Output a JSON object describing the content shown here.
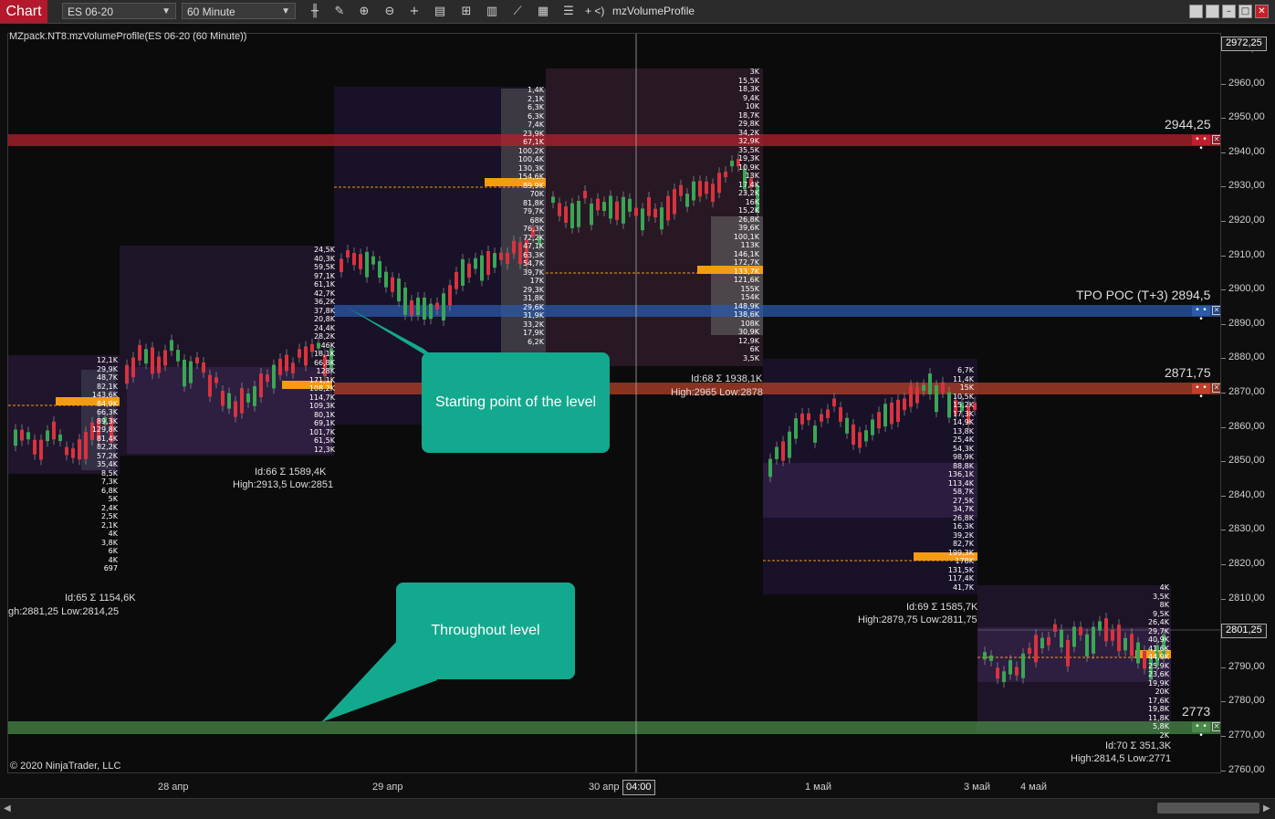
{
  "toolbar": {
    "chart_label": "Chart",
    "instrument": "ES 06-20",
    "interval": "60 Minute",
    "indicator_label": "mzVolumeProfile",
    "nav_text": "+ <)",
    "icons": [
      "bars-icon",
      "pencil-icon",
      "zoom-in-icon",
      "zoom-out-icon",
      "crosshair-icon",
      "data-box-icon",
      "strategy-icon",
      "chart-style-icon",
      "drawing-tools-icon",
      "properties-icon",
      "templates-icon"
    ]
  },
  "chart": {
    "indicator_title": "MZpack.NT8.mzVolumeProfile(ES 06-20 (60 Minute))",
    "copyright": "© 2020 NinjaTrader, LLC",
    "y_axis": {
      "ticks": [
        "2970,00",
        "2960,00",
        "2950,00",
        "2940,00",
        "2930,00",
        "2920,00",
        "2910,00",
        "2900,00",
        "2890,00",
        "2880,00",
        "2870,00",
        "2860,00",
        "2850,00",
        "2840,00",
        "2830,00",
        "2820,00",
        "2810,00",
        "2800,00",
        "2790,00",
        "2780,00",
        "2770,00",
        "2760,00"
      ],
      "top_flag": "2972,25",
      "price_flag": "2801,25"
    },
    "x_axis": {
      "labels": [
        "28 апр",
        "29 апр",
        "30 апр",
        "1 май",
        "3 май",
        "4 май"
      ],
      "cursor_flag": "04:00"
    },
    "levels": [
      {
        "label": "2944,25",
        "color": "#b3202e"
      },
      {
        "label": "TPO POC (T+3) 2894,5",
        "color": "#2a5aa8"
      },
      {
        "label": "2871,75",
        "color": "#b3402a"
      },
      {
        "label": "2773",
        "color": "#4a8a4a"
      }
    ],
    "profiles": [
      {
        "id_line": "Id:65 Σ 1154,6K",
        "range_line": "gh:2881,25 Low:2814,25"
      },
      {
        "id_line": "Id:66 Σ 1589,4K",
        "range_line": "High:2913,5 Low:2851"
      },
      {
        "id_line": "Id:68 Σ 1938,1K",
        "range_line": "High:2965 Low:2878"
      },
      {
        "id_line": "Id:69 Σ 1585,7K",
        "range_line": "High:2879,75 Low:2811,75"
      },
      {
        "id_line": "Id:70 Σ 351,3K",
        "range_line": "High:2814,5 Low:2771"
      }
    ],
    "volume_columns": {
      "p65": [
        "12,1K",
        "29,9K",
        "48,7K",
        "82,1K",
        "143,6K",
        "84,9K",
        "66,3K",
        "89,3K",
        "129,8K",
        "81,4K",
        "82,2K",
        "57,2K",
        "35,4K",
        "8,5K",
        "7,3K",
        "6,8K",
        "5K",
        "2,4K",
        "2,5K",
        "2,1K",
        "4K",
        "3,8K",
        "6K",
        "4K",
        "697"
      ],
      "p66": [
        "24,5K",
        "40,3K",
        "59,5K",
        "97,1K",
        "61,1K",
        "42,7K",
        "36,2K",
        "37,8K",
        "20,8K",
        "24,4K",
        "28,2K",
        "46K",
        "18,1K",
        "66,8K",
        "128K",
        "171,1K",
        "108,2K",
        "114,7K",
        "109,3K",
        "80,1K",
        "69,1K",
        "101,7K",
        "61,5K",
        "12,3K"
      ],
      "p67": [
        "1,4K",
        "2,1K",
        "6,3K",
        "6,3K",
        "7,4K",
        "23,9K",
        "67,1K",
        "100,2K",
        "100,4K",
        "130,3K",
        "154,6K",
        "89,9K",
        "70K",
        "81,8K",
        "79,7K",
        "68K",
        "76,3K",
        "72,2K",
        "47,1K",
        "63,3K",
        "54,7K",
        "39,7K",
        "17K",
        "29,3K",
        "31,8K",
        "29,6K",
        "31,9K",
        "33,2K",
        "17,9K",
        "6,2K"
      ],
      "p68": [
        "3K",
        "15,5K",
        "18,3K",
        "9,4K",
        "10K",
        "18,7K",
        "29,8K",
        "34,2K",
        "32,9K",
        "35,5K",
        "19,3K",
        "10,9K",
        "13K",
        "17,4K",
        "23,2K",
        "16K",
        "15,2K",
        "26,8K",
        "39,6K",
        "100,1K",
        "113K",
        "146,1K",
        "172,7K",
        "133,7K",
        "121,6K",
        "155K",
        "154K",
        "148,9K",
        "138,6K",
        "108K",
        "30,9K",
        "12,9K",
        "6K",
        "3,5K"
      ],
      "p69": [
        "6,7K",
        "11,4K",
        "15K",
        "10,5K",
        "15,2K",
        "17,3K",
        "14,9K",
        "13,8K",
        "25,4K",
        "54,3K",
        "98,9K",
        "88,8K",
        "136,1K",
        "113,4K",
        "58,7K",
        "27,5K",
        "34,7K",
        "26,8K",
        "16,3K",
        "39,2K",
        "82,7K",
        "199,3K",
        "178K",
        "131,5K",
        "117,4K",
        "41,7K"
      ],
      "p70": [
        "4K",
        "3,5K",
        "8K",
        "9,5K",
        "26,4K",
        "29,7K",
        "40,9K",
        "41,6K",
        "44,9K",
        "25,9K",
        "23,6K",
        "19,9K",
        "20K",
        "17,6K",
        "19,8K",
        "11,8K",
        "5,8K",
        "2K"
      ]
    }
  },
  "annotations": {
    "callout_start": "Starting point of the level",
    "callout_throughout": "Throughout level"
  },
  "colors": {
    "chart_tab": "#b3182c",
    "callout": "#13a98e",
    "up_candle": "#3aa655",
    "down_candle": "#d8333f",
    "profile_bg": "#2a1a3a",
    "poc": "#f39c12"
  }
}
